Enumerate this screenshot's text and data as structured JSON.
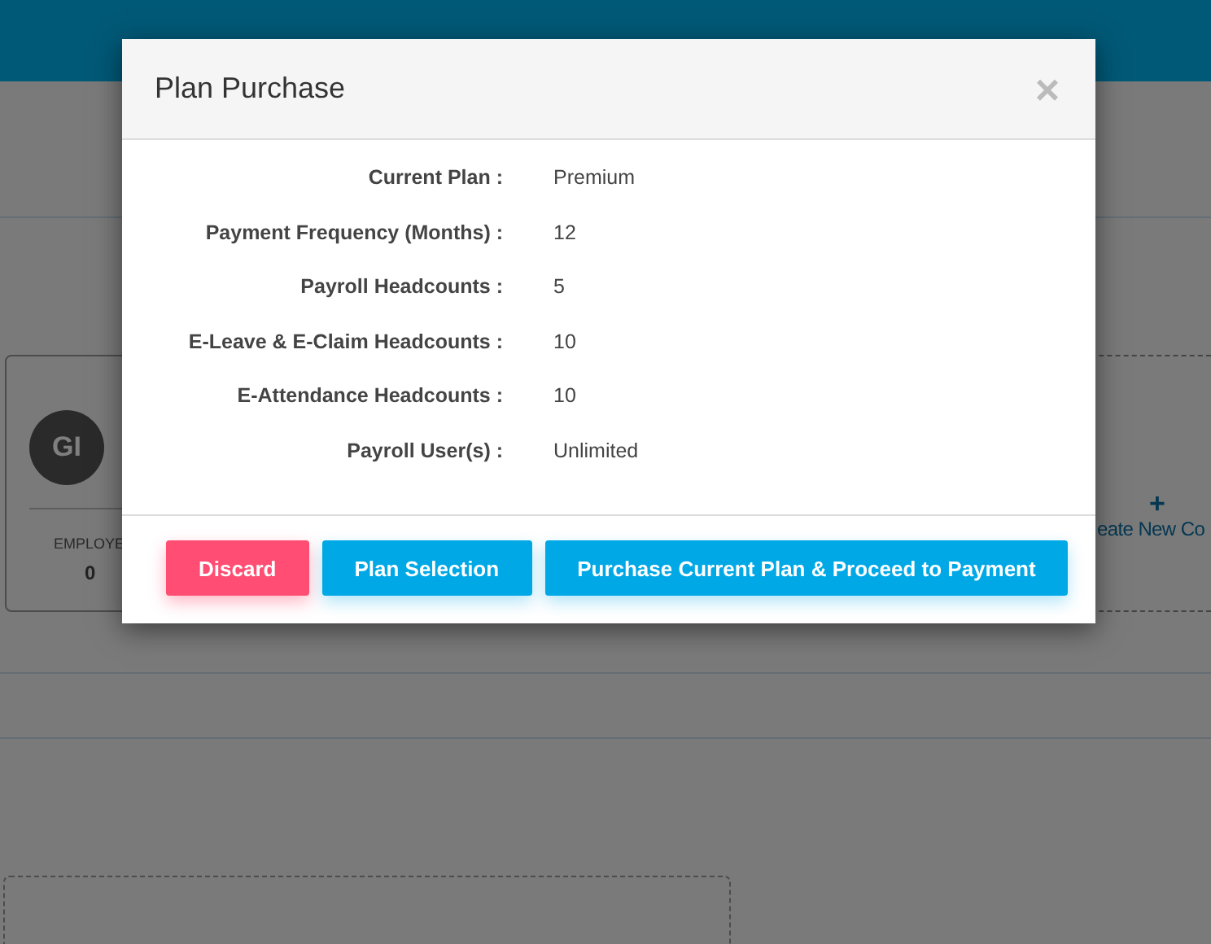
{
  "background": {
    "company_card": {
      "initials": "GI",
      "label": "EMPLOYE",
      "count": "0"
    },
    "create_card": {
      "icon": "+",
      "label": "eate New Co"
    }
  },
  "modal": {
    "title": "Plan Purchase",
    "close": "×",
    "fields": [
      {
        "label": "Current Plan :",
        "value": "Premium"
      },
      {
        "label": "Payment Frequency (Months) :",
        "value": "12"
      },
      {
        "label": "Payroll Headcounts :",
        "value": "5"
      },
      {
        "label": "E-Leave & E-Claim Headcounts :",
        "value": "10"
      },
      {
        "label": "E-Attendance Headcounts :",
        "value": "10"
      },
      {
        "label": "Payroll User(s) :",
        "value": "Unlimited"
      }
    ],
    "buttons": [
      {
        "label": "Discard",
        "kind": "danger"
      },
      {
        "label": "Plan Selection",
        "kind": "primary"
      },
      {
        "label": "Purchase Current Plan & Proceed to Payment",
        "kind": "primary"
      }
    ]
  }
}
